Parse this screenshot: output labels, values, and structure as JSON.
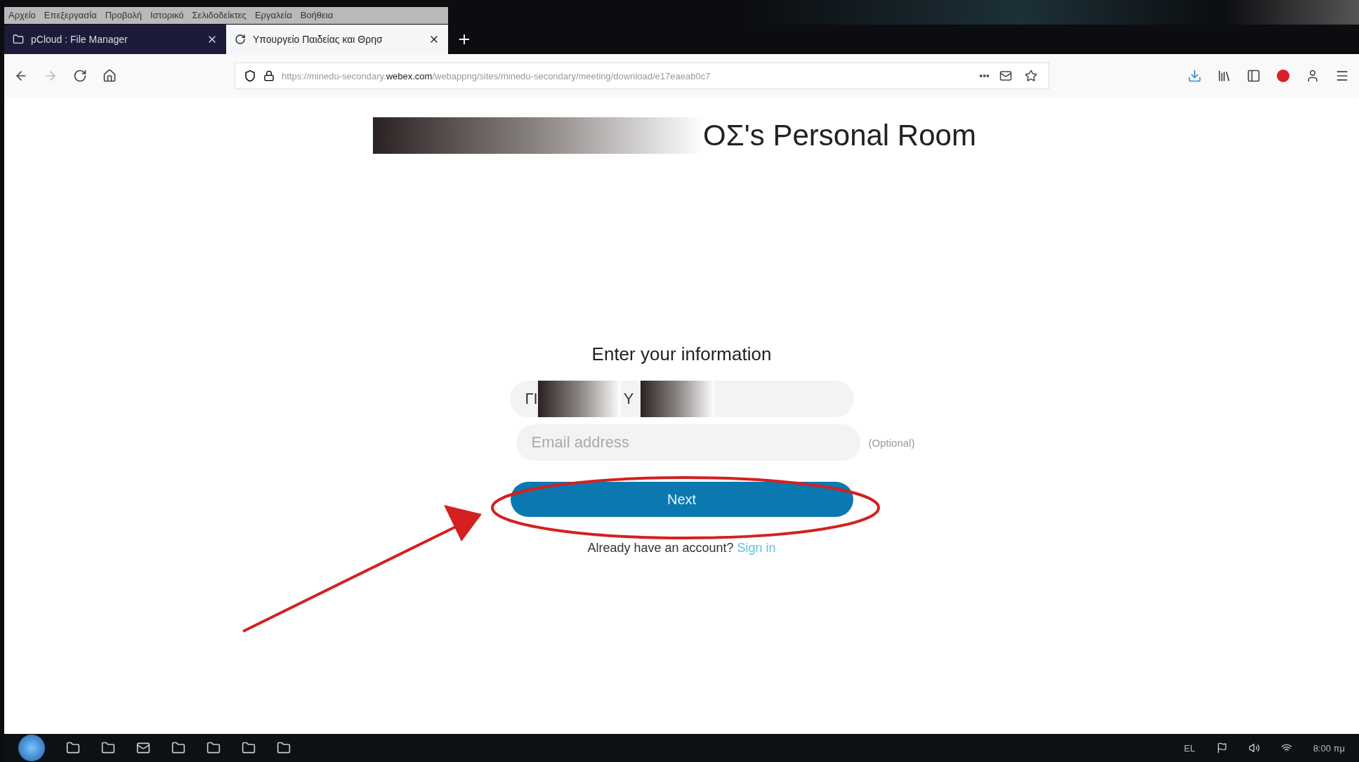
{
  "menu_bar": [
    "Αρχείο",
    "Επεξεργασία",
    "Προβολή",
    "Ιστορικό",
    "Σελιδοδείκτες",
    "Εργαλεία",
    "Βοήθεια"
  ],
  "tabs": [
    {
      "label": "pCloud : File Manager",
      "selected": false
    },
    {
      "label": "Υπουργείο Παιδείας και Θρησ",
      "selected": true
    }
  ],
  "address_bar": {
    "url_prefix": "https://minedu-secondary.",
    "url_domain": "webex.com",
    "url_rest": "/webappng/sites/minedu-secondary/meeting/download/e17eaeab0c7",
    "more": "•••"
  },
  "page": {
    "title": "ΟΣ's Personal Room",
    "form_title": "Enter your information",
    "name_field": {
      "value_parts": [
        "ΓΙ",
        "Υ"
      ]
    },
    "email_field": {
      "placeholder": "Email address",
      "note": "(Optional)"
    },
    "next_button": "Next",
    "account_prompt": "Already have an account?",
    "sign_in_link": "Sign in"
  },
  "taskbar": {
    "language": "EL",
    "clock": "8:00 πμ"
  }
}
